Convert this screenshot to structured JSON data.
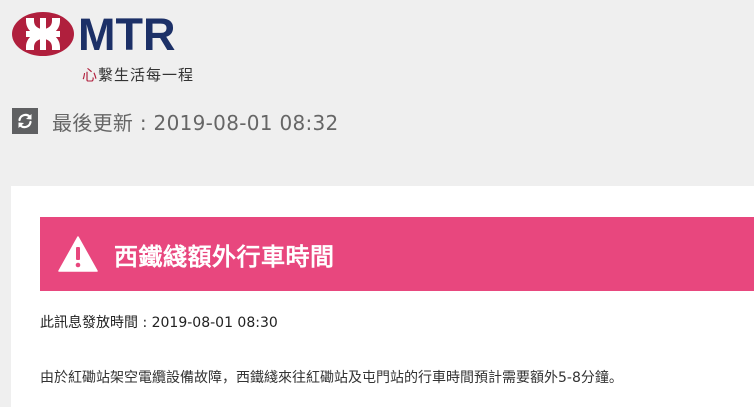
{
  "brand": {
    "name": "MTR",
    "tagline_mark": "心",
    "tagline_rest": "繫生活每一程",
    "colors": {
      "primary_red": "#b01f3d",
      "navy": "#1c3067"
    }
  },
  "update": {
    "icon": "refresh-icon",
    "text": "最後更新 : 2019-08-01 08:32"
  },
  "alert": {
    "icon": "warning-triangle-icon",
    "title": "西鐵綫額外行車時間",
    "banner_color": "#e8477e",
    "issued": "此訊息發放時間 : 2019-08-01 08:30",
    "message": "由於紅磡站架空電纜設備故障，西鐵綫來往紅磡站及屯門站的行車時間預計需要額外5-8分鐘。"
  }
}
